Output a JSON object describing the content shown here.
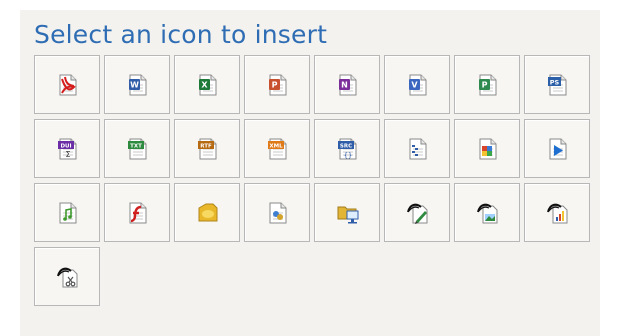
{
  "dialog": {
    "title": "Select an icon to insert"
  },
  "icons": [
    {
      "name": "pdf-icon",
      "color": "#d61d1d"
    },
    {
      "name": "word-doc-icon",
      "color": "#2f5da8"
    },
    {
      "name": "excel-icon",
      "color": "#1f7a3a"
    },
    {
      "name": "powerpoint-icon",
      "color": "#c9502f"
    },
    {
      "name": "onenote-icon",
      "color": "#7c2f9a"
    },
    {
      "name": "visio-icon",
      "color": "#3b67c1"
    },
    {
      "name": "project-icon",
      "color": "#2f8a4f"
    },
    {
      "name": "photoshop-icon",
      "color": "#2b5fa8"
    },
    {
      "name": "dui-formula-icon",
      "color": "#6b2ea6",
      "text": "DUI"
    },
    {
      "name": "txt-file-icon",
      "color": "#2e8a3f",
      "text": "TXT"
    },
    {
      "name": "rtf-file-icon",
      "color": "#b66a12",
      "text": "RTF"
    },
    {
      "name": "xml-file-icon",
      "color": "#e07a17",
      "text": "XML"
    },
    {
      "name": "src-code-icon",
      "color": "#2f5da8",
      "text": "SRC"
    },
    {
      "name": "outline-doc-icon",
      "color": "#2f5da8"
    },
    {
      "name": "image-file-icon",
      "color": "#d8452b"
    },
    {
      "name": "video-play-icon",
      "color": "#1f6fd1"
    },
    {
      "name": "audio-file-icon",
      "color": "#3f9a2e"
    },
    {
      "name": "flash-icon",
      "color": "#cf1f1f"
    },
    {
      "name": "note-badge-icon",
      "color": "#e8b72a"
    },
    {
      "name": "shared-doc-icon",
      "color": "#3f7fcf"
    },
    {
      "name": "folder-screen-icon",
      "color": "#e3b537"
    },
    {
      "name": "sketch-pen-icon",
      "color": "#2f8a3f"
    },
    {
      "name": "sketch-image-icon",
      "color": "#2f8a3f"
    },
    {
      "name": "sketch-chart-icon",
      "color": "#2f5da8"
    },
    {
      "name": "sketch-scissors-icon",
      "color": "#555555"
    }
  ]
}
